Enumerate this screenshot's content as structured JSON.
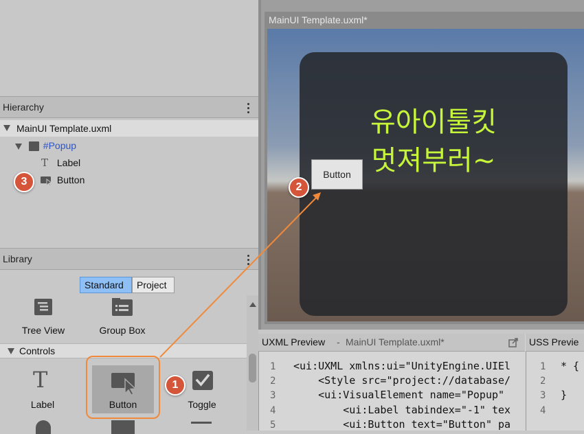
{
  "hierarchy": {
    "title": "Hierarchy",
    "file": "MainUI Template.uxml",
    "popup": "#Popup",
    "label": "Label",
    "button": "Button"
  },
  "library": {
    "title": "Library",
    "tabs": [
      "Standard",
      "Project"
    ],
    "items_top": [
      "Tree View",
      "Group Box"
    ],
    "section": "Controls",
    "items_controls": [
      "Label",
      "Button",
      "Toggle"
    ]
  },
  "viewport": {
    "title": "MainUI Template.uxml*",
    "popup_text_line1": "유아이툴킷",
    "popup_text_line2": "멋져부러~",
    "button_text": "Button"
  },
  "uxml_preview": {
    "title": "UXML Preview",
    "separator": "-",
    "file": "MainUI Template.uxml*",
    "lines": [
      "<ui:UXML xmlns:ui=\"UnityEngine.UIEl",
      "    <Style src=\"project://database/",
      "    <ui:VisualElement name=\"Popup\" ",
      "        <ui:Label tabindex=\"-1\" tex",
      "        <ui:Button text=\"Button\" pa"
    ],
    "line_numbers": [
      "1",
      "2",
      "3",
      "4",
      "5"
    ]
  },
  "uss_preview": {
    "title": "USS Previe",
    "lines": [
      "* {",
      "",
      "}",
      ""
    ],
    "line_numbers": [
      "1",
      "2",
      "3",
      "4"
    ]
  },
  "badges": [
    "1",
    "2",
    "3"
  ],
  "colors": {
    "accent_orange": "#f08a3a",
    "badge_red": "#d4553a",
    "label_green": "#c6f53a",
    "tab_active": "#8fc0f5",
    "popup_blue_text": "#2d55c8"
  }
}
